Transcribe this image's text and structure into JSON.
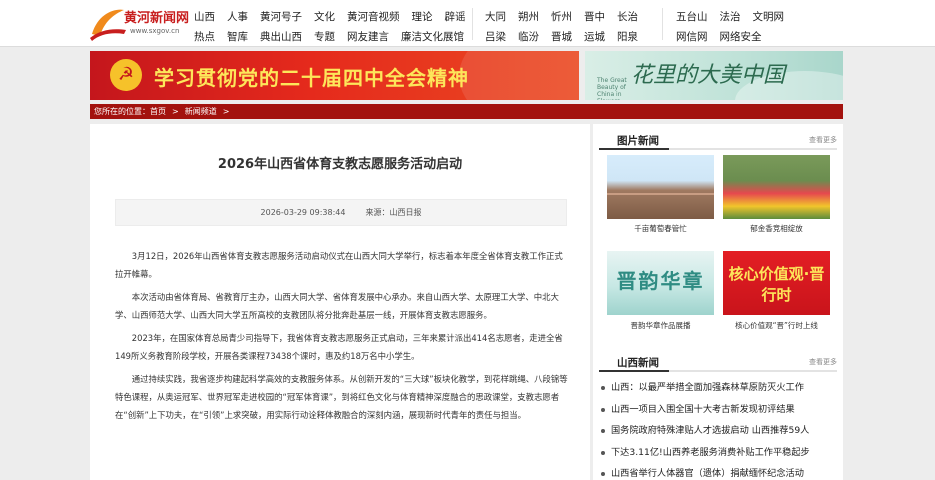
{
  "header": {
    "logo_text": "黄河新闻网",
    "logo_url": "www.sxgov.cn",
    "nav_group_1": [
      [
        "山西",
        "人事",
        "黄河号子",
        "文化",
        "黄河音视频",
        "理论",
        "辟谣"
      ],
      [
        "热点",
        "智库",
        "典出山西",
        "专题",
        "网友建言",
        "廉洁文化展馆"
      ]
    ],
    "nav_group_2": [
      [
        "大同",
        "朔州",
        "忻州",
        "晋中",
        "长治"
      ],
      [
        "吕梁",
        "临汾",
        "晋城",
        "运城",
        "阳泉"
      ]
    ],
    "nav_group_3": [
      [
        "五台山",
        "法治",
        "文明网"
      ],
      [
        "网信网",
        "网络安全"
      ]
    ]
  },
  "banner": {
    "red_text": "学习贯彻党的二十届四中全会精神",
    "green_title": "花里的大美中国",
    "green_sub": "The Great Beauty of China in Flowers"
  },
  "breadcrumb": {
    "prefix": "您所在的位置：",
    "home": "首页",
    "arrow": ">",
    "channel": "新闻频道",
    "trail": ">"
  },
  "article": {
    "title": "2026年山西省体育支教志愿服务活动启动",
    "date": "2026-03-29 09:38:44",
    "source": "来源：山西日报",
    "paragraphs": [
      "3月12日，2026年山西省体育支教志愿服务活动启动仪式在山西大同大学举行，标志着本年度全省体育支教工作正式拉开帷幕。",
      "本次活动由省体育局、省教育厅主办，山西大同大学、省体育发展中心承办。来自山西大学、太原理工大学、中北大学、山西师范大学、山西大同大学五所高校的支教团队将分批奔赴基层一线，开展体育支教志愿服务。",
      "2023年，在国家体育总局青少司指导下，我省体育支教志愿服务正式启动，三年来累计派出414名志愿者，走进全省149所义务教育阶段学校，开展各类课程73438个课时，惠及约18万名中小学生。",
      "通过持续实践，我省逐步构建起科学高效的支教服务体系。从创新开发的“三大球”板块化教学，到花样跳绳、八段锦等特色课程，从奥运冠军、世界冠军走进校园的“冠军体育课”，到将红色文化与体育精神深度融合的思政课堂，支教志愿者在“创新”上下功夫，在“引领”上求突破，用实际行动诠释体教融合的深刻内涵，展现新时代青年的责任与担当。"
    ]
  },
  "sidebar": {
    "photo_news": {
      "title": "图片新闻",
      "more": "查看更多",
      "items": [
        {
          "caption": "千亩葡萄春管忙"
        },
        {
          "caption": "郁金香竞相绽放"
        },
        {
          "caption": "晋韵华章作品展播",
          "overlay": "晋韵华章"
        },
        {
          "caption": "核心价值观“晋”行时上线",
          "overlay": "核心价值观·晋行时"
        }
      ]
    },
    "shanxi_news": {
      "title": "山西新闻",
      "more": "查看更多",
      "items": [
        "山西：以最严举措全面加强森林草原防灭火工作",
        "山西一项目入围全国十大考古新发现初评结果",
        "国务院政府特殊津贴人才选拔启动 山西推荐59人",
        "下达3.11亿!山西养老服务消费补贴工作平稳起步",
        "山西省举行人体器官（遗体）捐献缅怀纪念活动"
      ]
    }
  },
  "colors": {
    "brand_red": "#a3120e",
    "banner_red": "#e52a1c",
    "banner_text_yellow": "#fde65a",
    "page_bg": "#ededed"
  }
}
